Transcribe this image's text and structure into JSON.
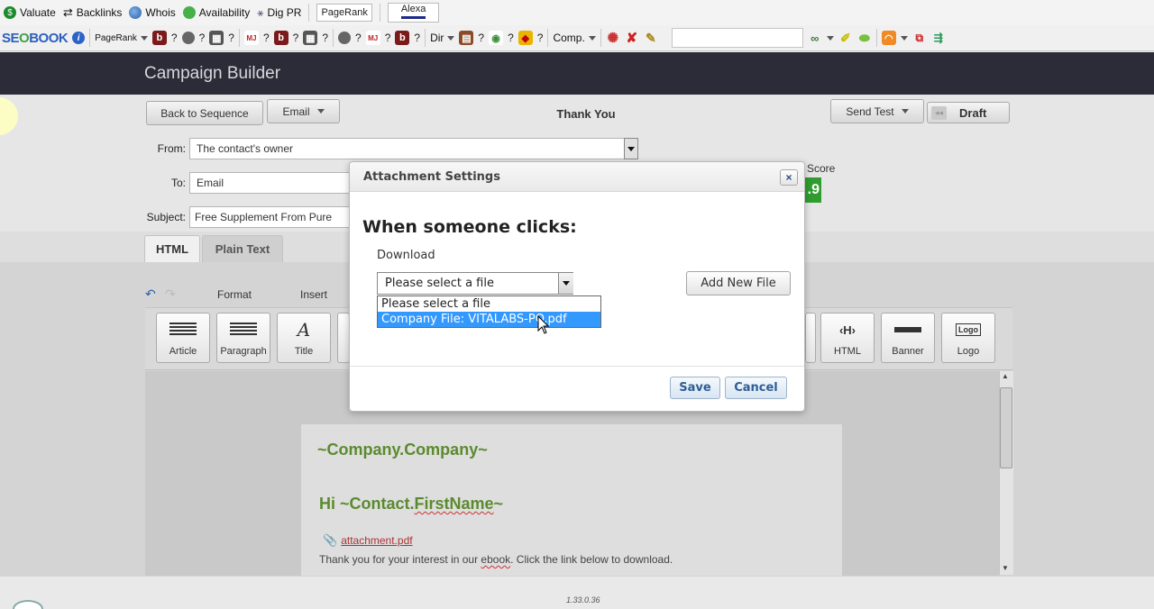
{
  "browser_toolbar_1": {
    "valuate": "Valuate",
    "backlinks": "Backlinks",
    "whois": "Whois",
    "availability": "Availability",
    "dig_pr": "Dig PR",
    "pagerank": "PageRank",
    "alexa": "Alexa"
  },
  "browser_toolbar_2": {
    "brand": "SEOBOOK",
    "pagerank": "PageRank",
    "q": "?",
    "dir": "Dir",
    "comp": "Comp.",
    "search_value": ""
  },
  "app": {
    "title": "Campaign Builder"
  },
  "header_actions": {
    "back": "Back to Sequence",
    "email": "Email",
    "page_title": "Thank You",
    "send_test": "Send Test",
    "draft": "Draft"
  },
  "form": {
    "from_label": "From:",
    "from_value": "The contact's owner",
    "to_label": "To:",
    "to_value": "Email",
    "subject_label": "Subject:",
    "subject_value": "Free Supplement From Pure",
    "score_label": "Score",
    "score_value": ".9"
  },
  "tabs": [
    "HTML",
    "Plain Text"
  ],
  "editor_menu": {
    "format": "Format",
    "insert": "Insert"
  },
  "blocks": {
    "article": "Article",
    "paragraph": "Paragraph",
    "title": "Title",
    "html": "HTML",
    "banner": "Banner",
    "logo": "Logo",
    "logo_icon_text": "Logo"
  },
  "email_preview": {
    "company": "~Company.Company~",
    "greeting": "Hi ~Contact.FirstName~",
    "attachment_link": "attachment.pdf",
    "body_text": "Thank you for your interest in our ebook. Click the link below to download."
  },
  "version": "1.33.0.36",
  "modal": {
    "title": "Attachment Settings",
    "close": "×",
    "heading": "When someone clicks:",
    "action_label": "Download",
    "select_value": "Please select a file",
    "options": [
      "Please select a file",
      "Company File: VITALABS-PO.pdf"
    ],
    "selected_index": 1,
    "add_new_file": "Add New File",
    "save": "Save",
    "cancel": "Cancel"
  },
  "colors": {
    "app_header": "#2c2c38",
    "email_green": "#5b8a2e",
    "score_green": "#2e9d2e",
    "dropdown_highlight": "#3399ff",
    "modal_button_text": "#2d5e95"
  }
}
